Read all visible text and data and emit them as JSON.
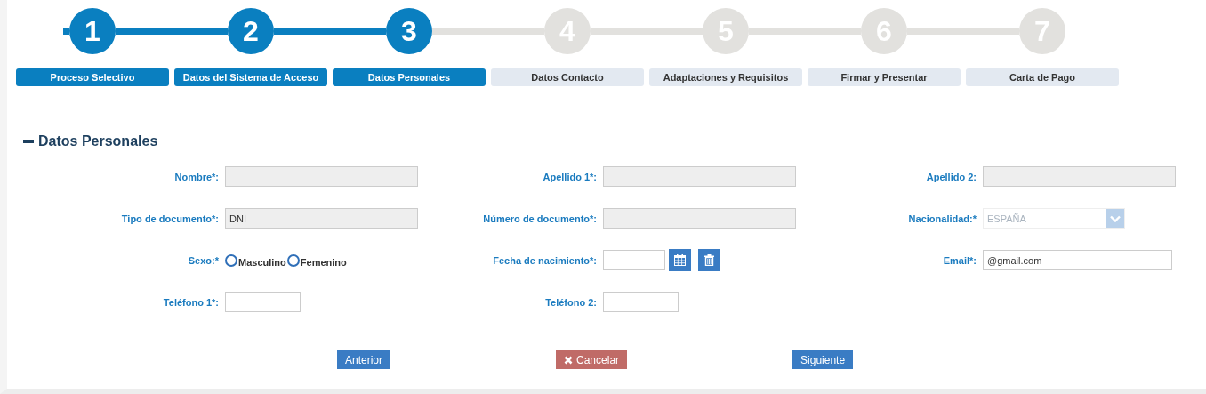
{
  "steps": [
    {
      "number": "1",
      "label": "Proceso Selectivo",
      "active": true
    },
    {
      "number": "2",
      "label": "Datos del Sistema de Acceso",
      "active": true
    },
    {
      "number": "3",
      "label": "Datos Personales",
      "active": true
    },
    {
      "number": "4",
      "label": "Datos Contacto",
      "active": false
    },
    {
      "number": "5",
      "label": "Adaptaciones y Requisitos",
      "active": false
    },
    {
      "number": "6",
      "label": "Firmar y Presentar",
      "active": false
    },
    {
      "number": "7",
      "label": "Carta de Pago",
      "active": false
    }
  ],
  "section": {
    "title": "Datos Personales",
    "expanded": true
  },
  "fields": [
    {
      "label": "Nombre*:",
      "kind": "text",
      "readonly": true
    },
    {
      "label": "Apellido 1*:",
      "kind": "text",
      "readonly": true
    },
    {
      "label": "Apellido 2:",
      "kind": "text",
      "readonly": true
    },
    {
      "label": "Tipo de documento*:",
      "kind": "text",
      "readonly": true,
      "value": "DNI"
    },
    {
      "label": "Número de documento*:",
      "kind": "text",
      "readonly": true
    },
    {
      "label": "Nacionalidad:*",
      "kind": "select",
      "disabled": true,
      "value": "ESPAÑA"
    },
    {
      "label": "Sexo:*",
      "kind": "radio",
      "options": [
        {
          "label": "Masculino",
          "selected": false
        },
        {
          "label": "Femenino",
          "selected": false
        }
      ]
    },
    {
      "label": "Fecha de nacimiento*:",
      "kind": "date"
    },
    {
      "label": "Email*:",
      "kind": "email",
      "readonly": false,
      "value": "@gmail.com"
    },
    {
      "label": "Teléfono 1*:",
      "kind": "short"
    },
    {
      "label": "Teléfono 2:",
      "kind": "short"
    }
  ],
  "buttons": [
    {
      "label": "Anterior",
      "kind": "primary"
    },
    {
      "label": "Cancelar",
      "kind": "cancel"
    },
    {
      "label": "Siguiente",
      "kind": "primary"
    }
  ]
}
